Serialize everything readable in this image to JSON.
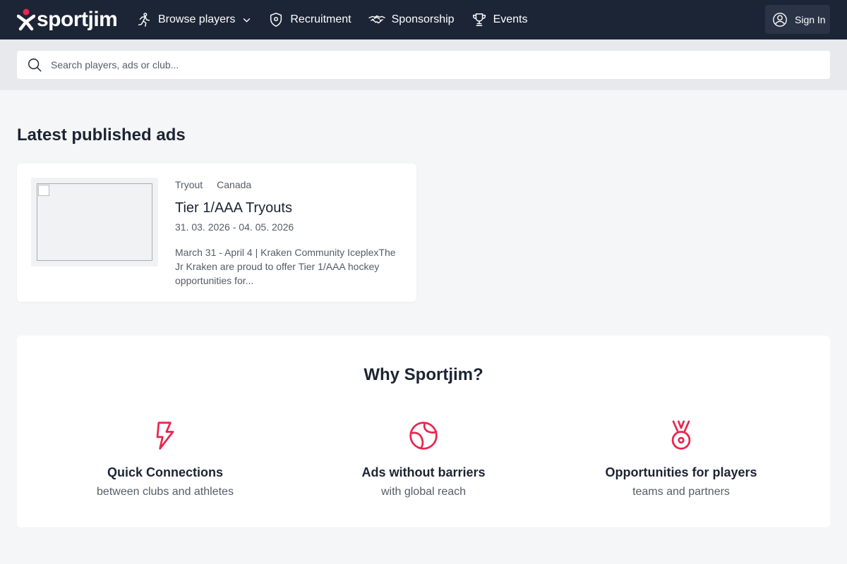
{
  "brand": {
    "name": "sportjim",
    "accent": "#e8264f",
    "nav_bg": "#1c2536"
  },
  "nav": {
    "items": [
      {
        "label": "Browse players",
        "icon": "runner-icon",
        "has_dropdown": true
      },
      {
        "label": "Recruitment",
        "icon": "shield-icon"
      },
      {
        "label": "Sponsorship",
        "icon": "handshake-icon"
      },
      {
        "label": "Events",
        "icon": "trophy-icon"
      }
    ],
    "signin_label": "Sign In"
  },
  "search": {
    "placeholder": "Search players, ads or club..."
  },
  "ads_section": {
    "title": "Latest published ads",
    "ads": [
      {
        "type": "Tryout",
        "location": "Canada",
        "title": "Tier 1/AAA Tryouts",
        "dates": "31. 03. 2026 - 04. 05. 2026",
        "description": "March 31 - April 4 | Kraken Community IceplexThe Jr Kraken are proud to offer Tier 1/AAA hockey opportunities for..."
      }
    ]
  },
  "why": {
    "title": "Why Sportjim?",
    "features": [
      {
        "icon": "lightning-icon",
        "title": "Quick Connections",
        "subtitle": "between clubs and athletes"
      },
      {
        "icon": "globe-icon",
        "title": "Ads without barriers",
        "subtitle": "with global reach"
      },
      {
        "icon": "medal-icon",
        "title": "Opportunities for players",
        "subtitle": "teams and partners"
      }
    ]
  }
}
